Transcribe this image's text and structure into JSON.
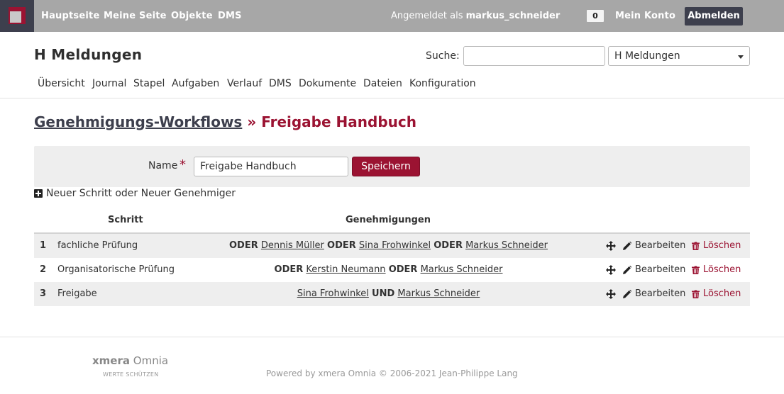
{
  "top_bar": {
    "links": [
      "Hauptseite",
      "Meine Seite",
      "Objekte",
      "DMS"
    ],
    "logged_in_prefix": "Angemeldet als",
    "username": "markus_schneider",
    "counter": "0",
    "account": "Mein Konto",
    "logout": "Abmelden"
  },
  "header": {
    "project_title": "H Meldungen",
    "search_label": "Suche:",
    "search_value": "",
    "project_select": "H Meldungen"
  },
  "menu": [
    "Übersicht",
    "Journal",
    "Stapel",
    "Aufgaben",
    "Verlauf",
    "DMS",
    "Dokumente",
    "Dateien",
    "Konfiguration"
  ],
  "breadcrumb": {
    "parent": "Genehmigungs-Workflows",
    "separator": "»",
    "current": "Freigabe Handbuch"
  },
  "form": {
    "name_label": "Name",
    "required_mark": "*",
    "name_value": "Freigabe Handbuch",
    "save": "Speichern"
  },
  "new_step": {
    "part1": "Neuer Schritt",
    "oder": "oder",
    "part2": "Neuer Genehmiger"
  },
  "table": {
    "headers": {
      "step": "Schritt",
      "approvals": "Genehmigungen"
    },
    "rows": [
      {
        "num": "1",
        "step": "fachliche Prüfung",
        "approvals": [
          {
            "conj": "ODER",
            "person": "Dennis Müller"
          },
          {
            "conj": "ODER",
            "person": "Sina Frohwinkel"
          },
          {
            "conj": "ODER",
            "person": "Markus Schneider"
          }
        ]
      },
      {
        "num": "2",
        "step": "Organisatorische Prüfung",
        "approvals": [
          {
            "conj": "ODER",
            "person": "Kerstin Neumann"
          },
          {
            "conj": "ODER",
            "person": "Markus Schneider"
          }
        ]
      },
      {
        "num": "3",
        "step": "Freigabe",
        "approvals": [
          {
            "conj": "",
            "person": "Sina Frohwinkel"
          },
          {
            "conj": "UND",
            "person": "Markus Schneider"
          }
        ]
      }
    ],
    "edit_label": "Bearbeiten",
    "delete_label": "Löschen"
  },
  "footer": {
    "brand_bold": "xmera",
    "brand_rest": "Omnia",
    "tagline": "WERTE SCHÜTZEN",
    "powered": "Powered by xmera Omnia © 2006-2021 Jean-Philippe Lang"
  },
  "colors": {
    "top_bar": "#a7a7a7",
    "dark": "#3d3f4d",
    "accent": "#9b1332",
    "form_bg": "#eeeeee"
  }
}
